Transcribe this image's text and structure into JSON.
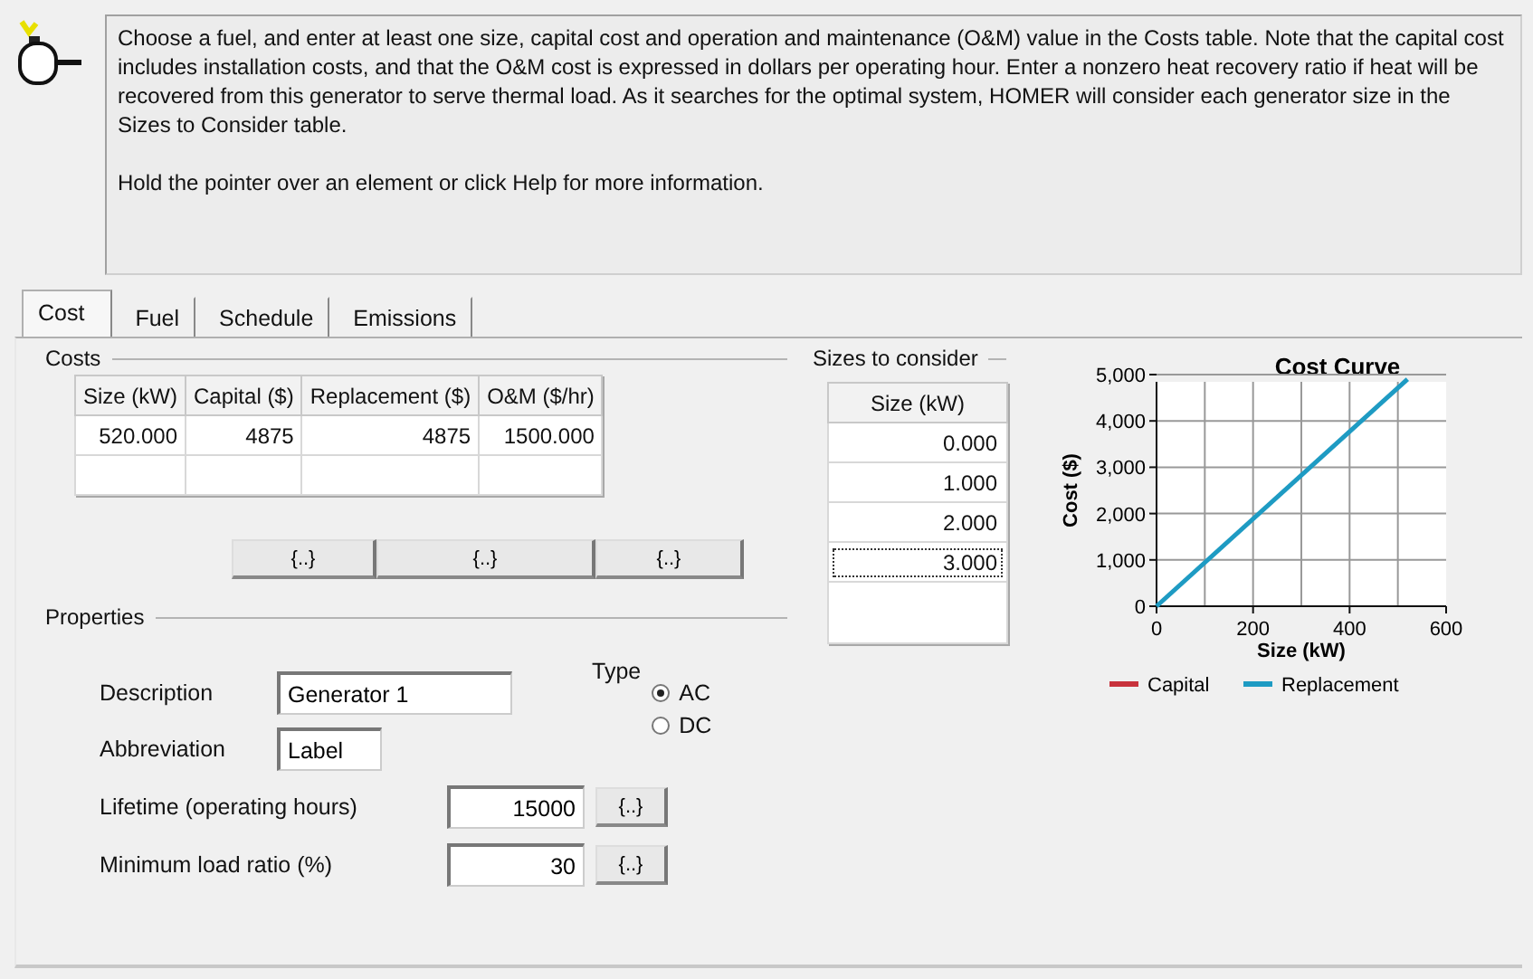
{
  "info": {
    "text": "Choose a fuel, and enter at least one size, capital cost and operation and maintenance (O&M) value in the Costs table. Note that the capital cost includes installation costs, and that the O&M cost is expressed in dollars per operating hour. Enter a nonzero heat recovery ratio if heat will be recovered from this generator to serve thermal load. As it searches for the optimal system, HOMER will consider each generator size in the Sizes to Consider table.",
    "hint": "Hold the pointer over an element or click Help for more information."
  },
  "tabs": [
    {
      "label": "Cost",
      "selected": true
    },
    {
      "label": "Fuel",
      "selected": false
    },
    {
      "label": "Schedule",
      "selected": false
    },
    {
      "label": "Emissions",
      "selected": false
    }
  ],
  "costs": {
    "title": "Costs",
    "columns": [
      "Size (kW)",
      "Capital ($)",
      "Replacement ($)",
      "O&M ($/hr)"
    ],
    "rows": [
      [
        "520.000",
        "4875",
        "4875",
        "1500.000"
      ]
    ],
    "buttons": [
      "{..}",
      "{..}",
      "{..}"
    ]
  },
  "properties": {
    "title": "Properties",
    "description": {
      "label": "Description",
      "value": "Generator 1"
    },
    "abbreviation": {
      "label": "Abbreviation",
      "value": "Label"
    },
    "type": {
      "label": "Type",
      "options": [
        {
          "label": "AC",
          "selected": true
        },
        {
          "label": "DC",
          "selected": false
        }
      ]
    },
    "fields": [
      {
        "label": "Lifetime (operating hours)",
        "value": "15000",
        "button": "{..}"
      },
      {
        "label": "Minimum load ratio (%)",
        "value": "30",
        "button": "{..}"
      }
    ]
  },
  "sizes": {
    "title": "Sizes to consider",
    "column": "Size (kW)",
    "rows": [
      {
        "value": "0.000",
        "selected": false
      },
      {
        "value": "1.000",
        "selected": false
      },
      {
        "value": "2.000",
        "selected": false
      },
      {
        "value": "3.000",
        "selected": true
      }
    ]
  },
  "chart": {
    "chart_data": {
      "type": "line",
      "title": "Cost Curve",
      "xlabel": "Size (kW)",
      "ylabel": "Cost ($)",
      "x": [
        0,
        520
      ],
      "series": [
        {
          "name": "Capital",
          "color": "#c8323c",
          "values": [
            null,
            null
          ]
        },
        {
          "name": "Replacement",
          "color": "#1e9bc3",
          "values": [
            0,
            4900
          ]
        }
      ],
      "grid": true,
      "legend": "bottom",
      "xlim": [
        0,
        600
      ],
      "ylim": [
        0,
        5000
      ],
      "xticks": [
        0,
        200,
        400,
        600
      ],
      "yticks": [
        0,
        {
          "value": 1000,
          "label": "1,000"
        },
        {
          "value": 2000,
          "label": "2,000"
        },
        {
          "value": 3000,
          "label": "3,000"
        },
        {
          "value": 4000,
          "label": "4,000"
        },
        {
          "value": 5000,
          "label": "5,000"
        }
      ]
    }
  }
}
